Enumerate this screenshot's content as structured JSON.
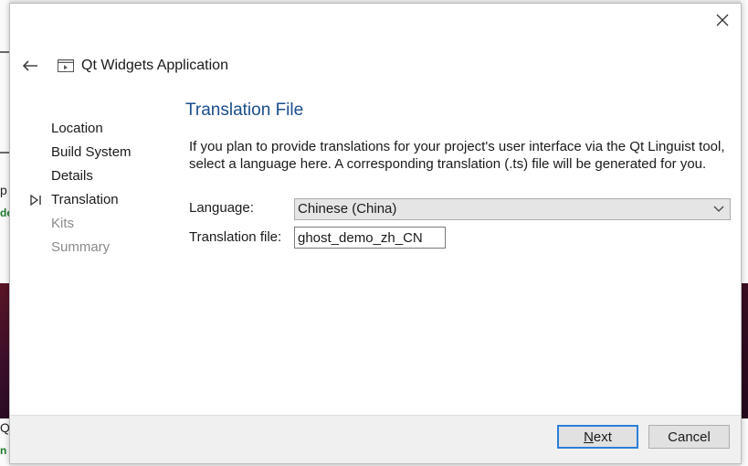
{
  "header": {
    "title": "Qt Widgets Application"
  },
  "steps": [
    {
      "label": "Location",
      "state": "done"
    },
    {
      "label": "Build System",
      "state": "done"
    },
    {
      "label": "Details",
      "state": "done"
    },
    {
      "label": "Translation",
      "state": "current"
    },
    {
      "label": "Kits",
      "state": "upcoming"
    },
    {
      "label": "Summary",
      "state": "upcoming"
    }
  ],
  "page": {
    "title": "Translation File",
    "description": "If you plan to provide translations for your project's user interface via the Qt Linguist tool, select a language here. A corresponding translation (.ts) file will be generated for you."
  },
  "form": {
    "language_label": "Language:",
    "language_value": "Chinese (China)",
    "file_label": "Translation file:",
    "file_value": "ghost_demo_zh_CN"
  },
  "buttons": {
    "next_mnemonic": "N",
    "next_rest": "ext",
    "cancel": "Cancel"
  },
  "background": {
    "left_glyphs": [
      "p",
      "de",
      "Qt",
      "n"
    ]
  },
  "colors": {
    "title_blue": "#1a4e8c",
    "primary_border": "#2b7fd8",
    "disabled_text": "#8a8a8a"
  }
}
